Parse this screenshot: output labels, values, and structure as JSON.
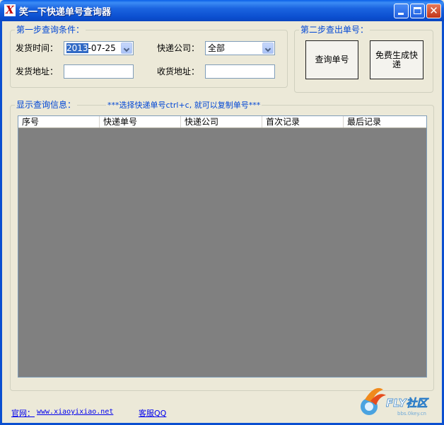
{
  "window": {
    "title": "笑一下快递单号查询器",
    "app_icon": "X"
  },
  "step1": {
    "legend": "第一步查询条件：",
    "ship_time_label": "发货时间：",
    "ship_time_value_sel": "2013",
    "ship_time_value_rest": "-07-25",
    "courier_label": "快递公司：",
    "courier_value": "全部",
    "ship_addr_label": "发货地址：",
    "ship_addr_value": "",
    "recv_addr_label": "收货地址：",
    "recv_addr_value": ""
  },
  "step2": {
    "legend": "第二步查出单号：",
    "query_button": "查询单号",
    "generate_button": "免费生成快递"
  },
  "results": {
    "legend": "显示查询信息：",
    "hint": "***选择快递单号ctrl+c, 就可以复制单号***",
    "columns": [
      "序号",
      "快递单号",
      "快递公司",
      "首次记录",
      "最后记录"
    ]
  },
  "footer": {
    "site_label": "官网：",
    "site_url": "www.xiaoyixiao.net",
    "support_link": "客服QQ"
  },
  "logo": {
    "brand": "FLY社区",
    "sub": "bbs.0key.cn"
  },
  "colors": {
    "title_bar": "#0b4fd0",
    "legend_text": "#0046d5",
    "grid_bg": "#808080",
    "close_button": "#c2351a"
  }
}
